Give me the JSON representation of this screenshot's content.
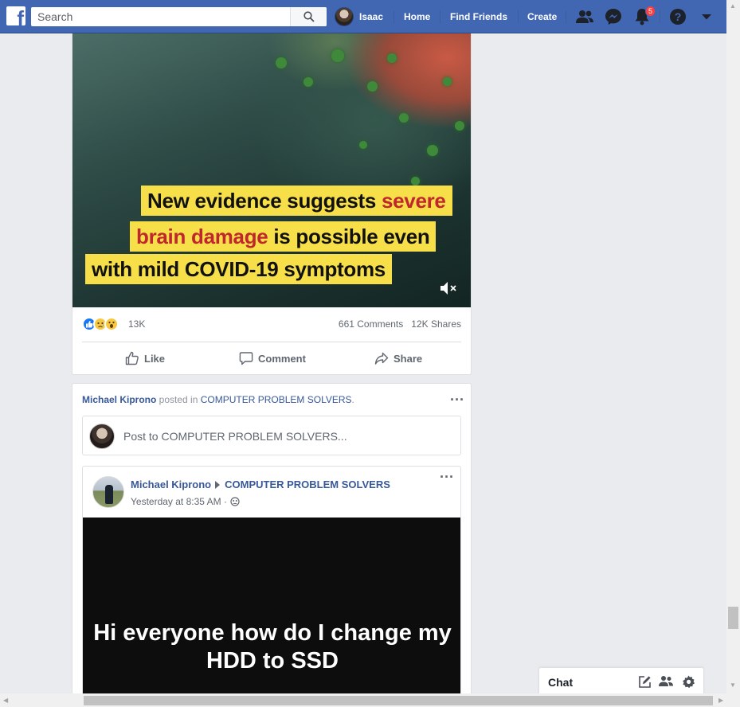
{
  "topbar": {
    "search_placeholder": "Search",
    "profile_name": "Isaac",
    "home": "Home",
    "find_friends": "Find Friends",
    "create": "Create",
    "notifications_count": "5"
  },
  "post1": {
    "caption_line1_a": "New evidence suggests ",
    "caption_line1_b": "severe",
    "caption_line2_a": "brain damage",
    "caption_line2_b": " is possible even",
    "caption_line3": "with mild COVID-19 symptoms",
    "reactions_count": "13K",
    "comments": "661 Comments",
    "shares": "12K Shares",
    "like_label": "Like",
    "comment_label": "Comment",
    "share_label": "Share"
  },
  "post2": {
    "poster_name": "Michael Kiprono",
    "posted_in": " posted in ",
    "group_name": "COMPUTER PROBLEM SOLVERS",
    "group_suffix": ".",
    "composer_placeholder": "Post to COMPUTER PROBLEM SOLVERS...",
    "shared_author": "Michael Kiprono",
    "shared_group": "COMPUTER PROBLEM SOLVERS",
    "shared_time": "Yesterday at 8:35 AM ·",
    "shared_text": "Hi everyone how do I change my HDD to SSD"
  },
  "chat": {
    "label": "Chat"
  }
}
